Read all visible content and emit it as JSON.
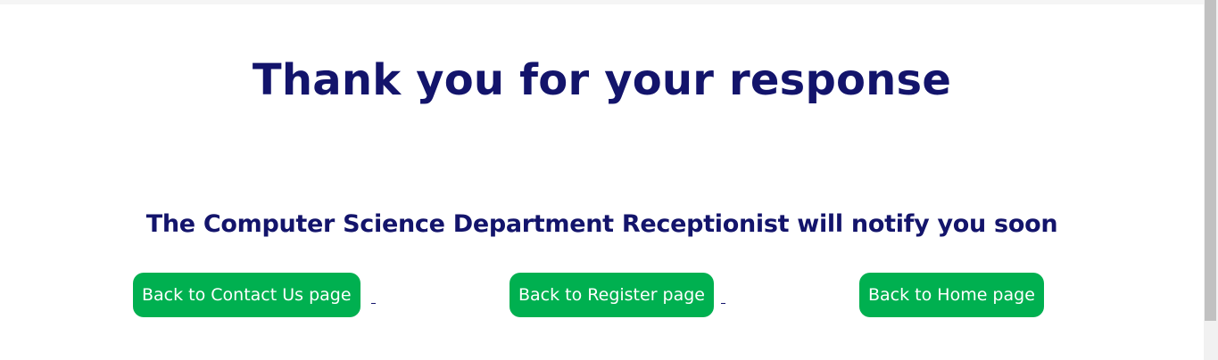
{
  "page": {
    "title": "Thank you for your response",
    "notice": "The Computer Science Department Receptionist will notify you soon"
  },
  "buttons": {
    "contact": "Back to Contact Us page",
    "register": "Back to Register page",
    "home": "Back to Home page"
  },
  "colors": {
    "heading": "#13146b",
    "button_bg": "#00b050",
    "button_text": "#ffffff",
    "background": "#ffffff"
  }
}
